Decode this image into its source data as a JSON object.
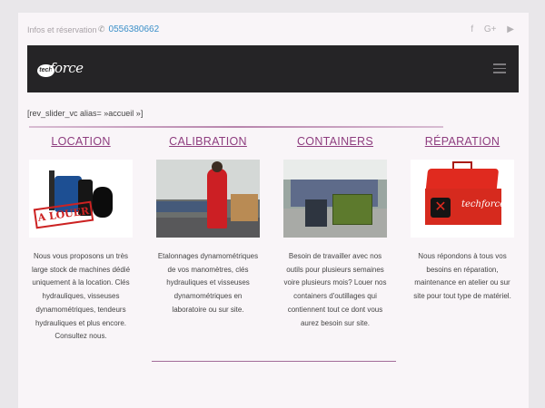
{
  "topbar": {
    "info_label": "Infos et réservation",
    "phone": "0556380662",
    "social_icons": [
      "facebook-icon",
      "google-plus-icon",
      "youtube-icon"
    ]
  },
  "header": {
    "logo_badge": "tech",
    "logo_word": "force",
    "menu_icon": "hamburger-icon"
  },
  "shortcode": "[rev_slider_vc alias= »accueil »]",
  "colors": {
    "accent": "#8e3d7f",
    "header_bg": "#252426",
    "link": "#3a8fc8"
  },
  "services": [
    {
      "title": "LOCATION",
      "image_text": "A LOUER",
      "description": "Nous vous proposons un très large stock de machines dédié uniquement à la location. Clés hydrauliques, visseuses dynamométriques, tendeurs hydrauliques et plus encore. Consultez nous."
    },
    {
      "title": "CALIBRATION",
      "description": "Etalonnages dynamométriques de vos manomètres, clés hydrauliques et visseuses dynamométriques en laboratoire ou sur site."
    },
    {
      "title": "CONTAINERS",
      "description": "Besoin de travailler avec nos outils pour plusieurs semaines voire plusieurs mois? Louer nos containers d'outillages qui contiennent tout ce dont vous aurez besoin sur site."
    },
    {
      "title": "RÉPARATION",
      "image_text": "techforce",
      "description": "Nous répondons à tous vos besoins en réparation, maintenance en atelier ou sur site pour tout type de matériel."
    }
  ]
}
